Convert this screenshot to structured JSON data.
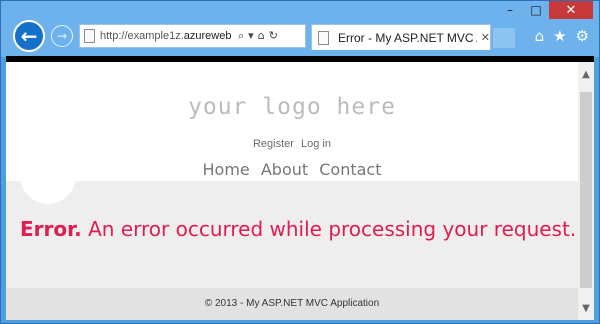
{
  "window": {
    "minimize": "–",
    "maximize": "□",
    "close": "✕"
  },
  "nav": {
    "back_icon": "←",
    "forward_icon": "→"
  },
  "address": {
    "url_prefix": "http://example1z.",
    "url_domain": "azureweb...",
    "search_icon": "⌕",
    "dropdown_icon": "▾",
    "compat_icon": "⌂",
    "refresh_icon": "↻"
  },
  "tab": {
    "title": "Error - My ASP.NET MVC A...",
    "close": "✕"
  },
  "toolbar": {
    "home_icon": "⌂",
    "favorites_icon": "★",
    "settings_icon": "⚙"
  },
  "site": {
    "logo": "your logo here",
    "register": "Register",
    "login": "Log in",
    "menu": [
      "Home",
      "About",
      "Contact"
    ],
    "error_title": "Error.",
    "error_message": "An error occurred while processing your request.",
    "footer": "© 2013 - My ASP.NET MVC Application"
  },
  "scrollbar": {
    "up": "▲",
    "down": "▼"
  }
}
